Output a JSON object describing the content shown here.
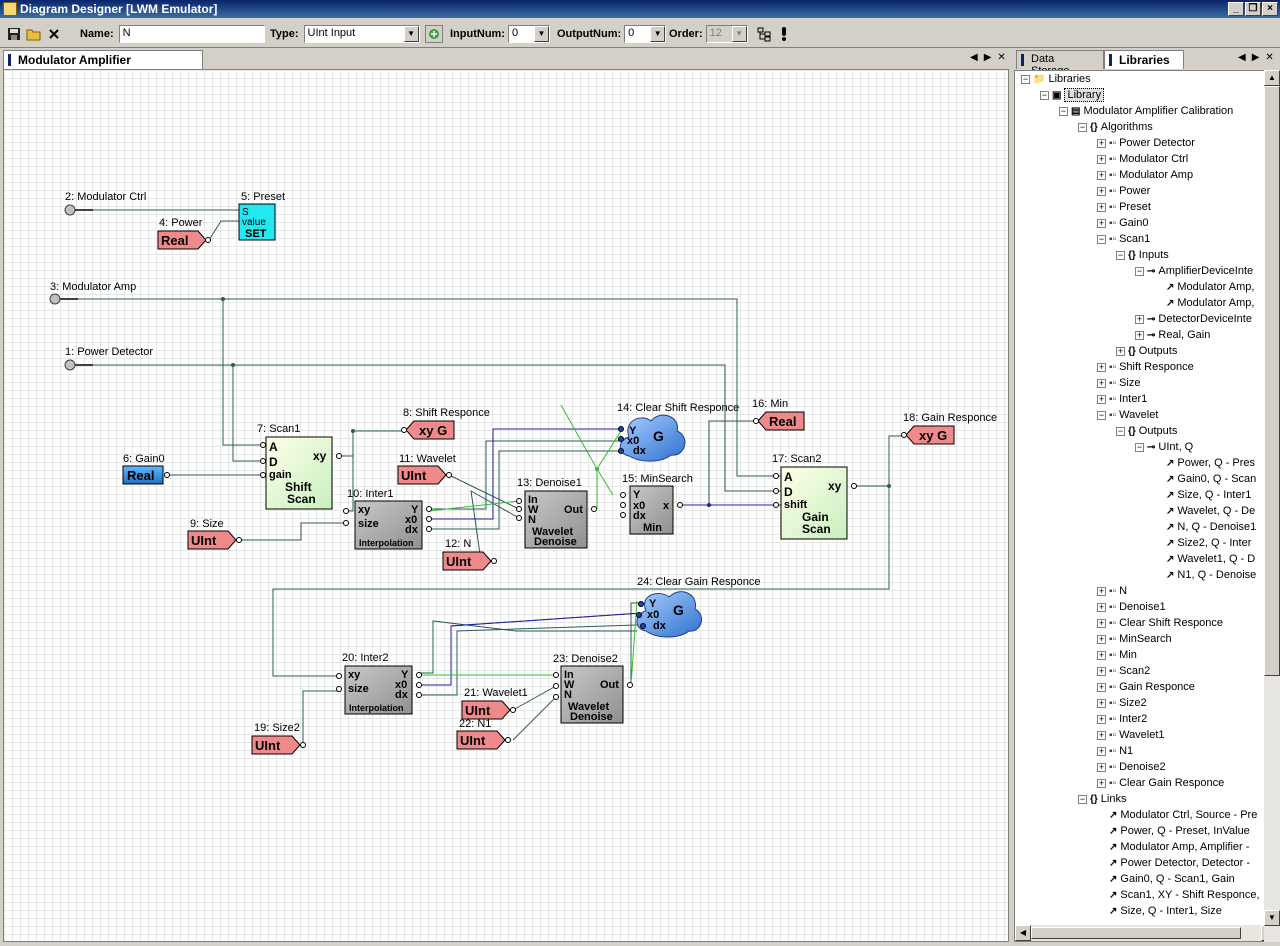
{
  "window": {
    "title": "Diagram Designer [LWM Emulator]",
    "min": "_",
    "restore": "❐",
    "close": "×"
  },
  "toolbar": {
    "name_label": "Name:",
    "name_value": "N",
    "type_label": "Type:",
    "type_value": "UInt Input",
    "inputnum_label": "InputNum:",
    "inputnum_value": "0",
    "outputnum_label": "OutputNum:",
    "outputnum_value": "0",
    "order_label": "Order:",
    "order_value": "12"
  },
  "editor_tab": {
    "label": "Modulator Amplifier Calibration"
  },
  "right_tabs": [
    {
      "label": "Data Storage"
    },
    {
      "label": "Libraries"
    }
  ],
  "diagram": {
    "nodes": {
      "n2": "2: Modulator Ctrl",
      "n5": "5: Preset",
      "n4": "4: Power",
      "n3": "3: Modulator Amp",
      "n1": "1: Power Detector",
      "n7": "7: Scan1",
      "n8": "8: Shift Responce",
      "n6": "6: Gain0",
      "n11": "11: Wavelet",
      "n13": "13: Denoise1",
      "n14": "14: Clear Shift Responce",
      "n16": "16: Min",
      "n17": "17: Scan2",
      "n18": "18: Gain Responce",
      "n10": "10: Inter1",
      "n9": "9: Size",
      "n12": "12: N",
      "n15": "15: MinSearch",
      "n24": "24: Clear Gain Responce",
      "n20": "20: Inter2",
      "n23": "23: Denoise2",
      "n21": "21: Wavelet1",
      "n22": "22: N1",
      "n19": "19: Size2"
    },
    "labels": {
      "real": "Real",
      "uint": "UInt",
      "xyg": "xy G",
      "preset_s": "S",
      "preset_value": "value",
      "preset_set": "SET",
      "scan_a": "A",
      "scan_d": "D",
      "scan_gain": "gain",
      "scan_shift": "shift",
      "scan_xy": "xy",
      "shift_scan": [
        "Shift",
        "Scan"
      ],
      "gain_scan": [
        "Gain",
        "Scan"
      ],
      "interp_xy": "xy",
      "interp_size": "size",
      "interp_y": "Y",
      "interp_x0": "x0",
      "interp_dx": "dx",
      "interp_footer": "Interpolation",
      "den_in": "In",
      "den_w": "W",
      "den_n": "N",
      "den_out": "Out",
      "den_title": [
        "Wavelet",
        "Denoise"
      ],
      "min_y": "Y",
      "min_x0": "x0",
      "min_dx": "dx",
      "min_x": "x",
      "min_title": "Min",
      "cloud_y": "Y",
      "cloud_x0": "x0",
      "cloud_dx": "dx",
      "cloud_g": "G"
    }
  },
  "tree": [
    {
      "label": "Libraries",
      "level": 0,
      "exp": "−",
      "icon": "folder"
    },
    {
      "label": "Library",
      "level": 1,
      "exp": "−",
      "icon": "lib"
    },
    {
      "label": "Modulator Amplifier Calibration",
      "level": 2,
      "exp": "−",
      "icon": "diag"
    },
    {
      "label": "Algorithms",
      "level": 3,
      "exp": "−",
      "icon": "brace"
    },
    {
      "label": "Power Detector",
      "level": 4,
      "exp": "+",
      "icon": "block"
    },
    {
      "label": "Modulator Ctrl",
      "level": 4,
      "exp": "+",
      "icon": "block"
    },
    {
      "label": "Modulator Amp",
      "level": 4,
      "exp": "+",
      "icon": "block"
    },
    {
      "label": "Power",
      "level": 4,
      "exp": "+",
      "icon": "block"
    },
    {
      "label": "Preset",
      "level": 4,
      "exp": "+",
      "icon": "block"
    },
    {
      "label": "Gain0",
      "level": 4,
      "exp": "+",
      "icon": "block"
    },
    {
      "label": "Scan1",
      "level": 4,
      "exp": "−",
      "icon": "block"
    },
    {
      "label": "Inputs",
      "level": 5,
      "exp": "−",
      "icon": "brace"
    },
    {
      "label": "AmplifierDeviceInte",
      "level": 6,
      "exp": "−",
      "icon": "pin"
    },
    {
      "label": "Modulator Amp,",
      "level": 7,
      "exp": "",
      "icon": "link"
    },
    {
      "label": "Modulator Amp,",
      "level": 7,
      "exp": "",
      "icon": "link"
    },
    {
      "label": "DetectorDeviceInte",
      "level": 6,
      "exp": "+",
      "icon": "pin"
    },
    {
      "label": "Real, Gain",
      "level": 6,
      "exp": "+",
      "icon": "pin"
    },
    {
      "label": "Outputs",
      "level": 5,
      "exp": "+",
      "icon": "brace"
    },
    {
      "label": "Shift Responce",
      "level": 4,
      "exp": "+",
      "icon": "block"
    },
    {
      "label": "Size",
      "level": 4,
      "exp": "+",
      "icon": "block"
    },
    {
      "label": "Inter1",
      "level": 4,
      "exp": "+",
      "icon": "block"
    },
    {
      "label": "Wavelet",
      "level": 4,
      "exp": "−",
      "icon": "block"
    },
    {
      "label": "Outputs",
      "level": 5,
      "exp": "−",
      "icon": "brace"
    },
    {
      "label": "UInt, Q",
      "level": 6,
      "exp": "−",
      "icon": "pin"
    },
    {
      "label": "Power, Q - Pres",
      "level": 7,
      "exp": "",
      "icon": "link"
    },
    {
      "label": "Gain0, Q - Scan",
      "level": 7,
      "exp": "",
      "icon": "link"
    },
    {
      "label": "Size, Q - Inter1",
      "level": 7,
      "exp": "",
      "icon": "link"
    },
    {
      "label": "Wavelet, Q - De",
      "level": 7,
      "exp": "",
      "icon": "link"
    },
    {
      "label": "N, Q - Denoise1",
      "level": 7,
      "exp": "",
      "icon": "link"
    },
    {
      "label": "Size2, Q - Inter",
      "level": 7,
      "exp": "",
      "icon": "link"
    },
    {
      "label": "Wavelet1, Q - D",
      "level": 7,
      "exp": "",
      "icon": "link"
    },
    {
      "label": "N1, Q - Denoise",
      "level": 7,
      "exp": "",
      "icon": "link"
    },
    {
      "label": "N",
      "level": 4,
      "exp": "+",
      "icon": "block"
    },
    {
      "label": "Denoise1",
      "level": 4,
      "exp": "+",
      "icon": "block"
    },
    {
      "label": "Clear Shift Responce",
      "level": 4,
      "exp": "+",
      "icon": "block"
    },
    {
      "label": "MinSearch",
      "level": 4,
      "exp": "+",
      "icon": "block"
    },
    {
      "label": "Min",
      "level": 4,
      "exp": "+",
      "icon": "block"
    },
    {
      "label": "Scan2",
      "level": 4,
      "exp": "+",
      "icon": "block"
    },
    {
      "label": "Gain Responce",
      "level": 4,
      "exp": "+",
      "icon": "block"
    },
    {
      "label": "Size2",
      "level": 4,
      "exp": "+",
      "icon": "block"
    },
    {
      "label": "Inter2",
      "level": 4,
      "exp": "+",
      "icon": "block"
    },
    {
      "label": "Wavelet1",
      "level": 4,
      "exp": "+",
      "icon": "block"
    },
    {
      "label": "N1",
      "level": 4,
      "exp": "+",
      "icon": "block"
    },
    {
      "label": "Denoise2",
      "level": 4,
      "exp": "+",
      "icon": "block"
    },
    {
      "label": "Clear Gain Responce",
      "level": 4,
      "exp": "+",
      "icon": "block"
    },
    {
      "label": "Links",
      "level": 3,
      "exp": "−",
      "icon": "brace"
    },
    {
      "label": "Modulator Ctrl, Source - Pre",
      "level": 4,
      "exp": "",
      "icon": "link"
    },
    {
      "label": "Power, Q - Preset, InValue",
      "level": 4,
      "exp": "",
      "icon": "link"
    },
    {
      "label": "Modulator Amp, Amplifier -",
      "level": 4,
      "exp": "",
      "icon": "link"
    },
    {
      "label": "Power Detector, Detector -",
      "level": 4,
      "exp": "",
      "icon": "link"
    },
    {
      "label": "Gain0, Q - Scan1, Gain",
      "level": 4,
      "exp": "",
      "icon": "link"
    },
    {
      "label": "Scan1, XY - Shift Responce,",
      "level": 4,
      "exp": "",
      "icon": "link"
    },
    {
      "label": "Size, Q - Inter1, Size",
      "level": 4,
      "exp": "",
      "icon": "link"
    }
  ],
  "tree_icons": {
    "folder": "📁",
    "lib": "▣",
    "diag": "▤",
    "brace": "{}",
    "block": "▪▫",
    "pin": "⊸",
    "link": "↗"
  },
  "colors": {
    "input_pink": "#f08a8a",
    "real_blue": "#3a9ae0",
    "preset_cyan": "#22e8f0",
    "scan_green": "#e8ffd8",
    "gray_block": "#a8a8a8",
    "cloud_blue": "#4a90e8"
  }
}
